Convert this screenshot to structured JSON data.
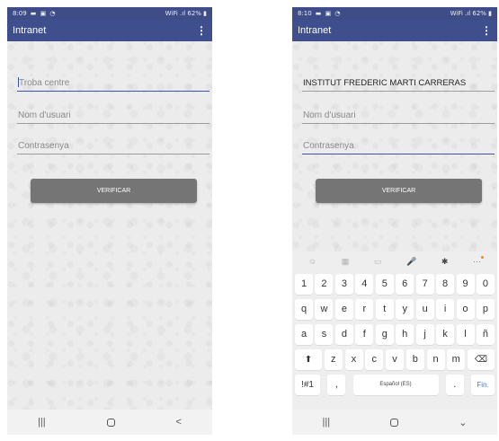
{
  "left_screen": {
    "status_bar": {
      "time": "8:09",
      "icons": "▬ ▣ ◔",
      "right": "WiFi .ıl 62% ▮"
    },
    "app_bar": {
      "title": "Intranet"
    },
    "fields": {
      "centre_placeholder": "Troba centre",
      "user_placeholder": "Nom d'usuari",
      "password_placeholder": "Contrasenya"
    },
    "verify_label": "VERIFICAR",
    "nav": {
      "recents": "|||",
      "back": "<"
    }
  },
  "right_screen": {
    "status_bar": {
      "time": "8:10",
      "icons": "▬ ▣ ◔",
      "right": "WiFi .ıl 62% ▮"
    },
    "app_bar": {
      "title": "Intranet"
    },
    "fields": {
      "centre_value": "INSTITUT FREDERIC MARTI CARRERAS",
      "user_placeholder": "Nom d'usuari",
      "password_placeholder": "Contrasenya"
    },
    "verify_label": "VERIFICAR",
    "keyboard": {
      "toolbar": [
        "☺",
        "▦",
        "▭",
        "🎤",
        "✱",
        "···"
      ],
      "row_numbers": [
        "1",
        "2",
        "3",
        "4",
        "5",
        "6",
        "7",
        "8",
        "9",
        "0"
      ],
      "row_q": [
        "q",
        "w",
        "e",
        "r",
        "t",
        "y",
        "u",
        "i",
        "o",
        "p"
      ],
      "row_a": [
        "a",
        "s",
        "d",
        "f",
        "g",
        "h",
        "j",
        "k",
        "l",
        "ñ"
      ],
      "row_z": [
        "z",
        "x",
        "c",
        "v",
        "b",
        "n",
        "m"
      ],
      "shift": "⬆",
      "backspace": "⌫",
      "symbols": "!#1",
      "comma": ",",
      "space": "Español (ES)",
      "period": ".",
      "action": "Fin."
    },
    "nav": {
      "recents": "|||",
      "collapse": "⌄"
    }
  }
}
